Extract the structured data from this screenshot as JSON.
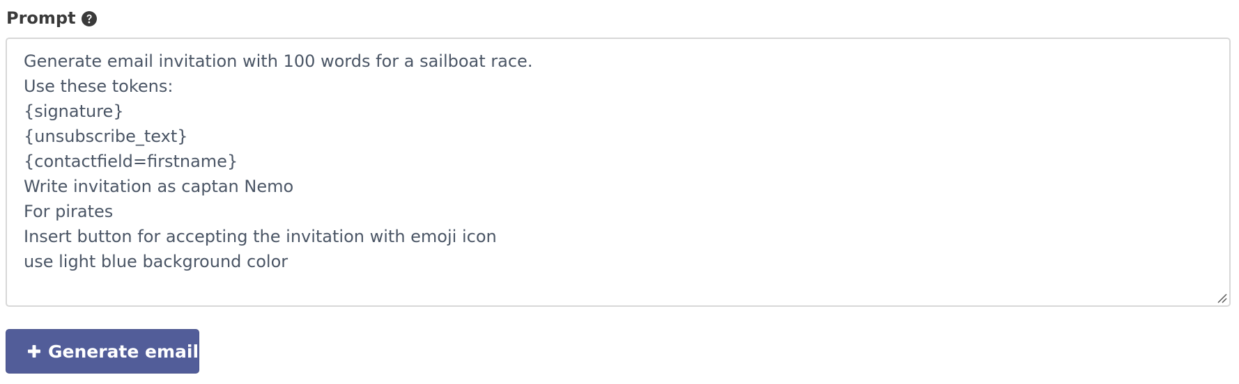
{
  "prompt_field": {
    "label": "Prompt",
    "help_icon": "question-circle-icon",
    "value": "Generate email invitation with 100 words for a sailboat race.\nUse these tokens:\n{signature}\n{unsubscribe_text}\n{contactfield=firstname}\nWrite invitation as captan Nemo\nFor pirates\nInsert button for accepting the invitation with emoji icon\nuse light blue background color"
  },
  "generate_button": {
    "icon": "plus-icon",
    "label": "Generate email"
  },
  "colors": {
    "button_bg": "#525d99",
    "text": "#4a5565",
    "label": "#3a3a3a",
    "border": "#d7d7d7"
  }
}
